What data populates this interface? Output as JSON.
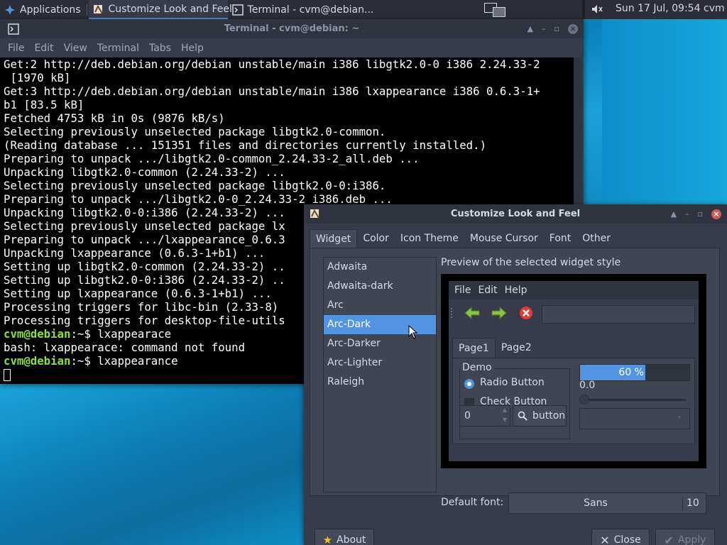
{
  "panel": {
    "applications_label": "Applications",
    "tasks": [
      {
        "label": "Customize Look and Feel",
        "active": true
      },
      {
        "label": "Terminal - cvm@debian..."
      }
    ],
    "clock": "Sun 17 Jul, 09:54",
    "user": "cvm"
  },
  "terminal": {
    "title": "Terminal - cvm@debian: ~",
    "menu": [
      "File",
      "Edit",
      "View",
      "Terminal",
      "Tabs",
      "Help"
    ],
    "lines": [
      "Get:2 http://deb.debian.org/debian unstable/main i386 libgtk2.0-0 i386 2.24.33-2",
      " [1970 kB]",
      "Get:3 http://deb.debian.org/debian unstable/main i386 lxappearance i386 0.6.3-1+",
      "b1 [83.5 kB]",
      "Fetched 4753 kB in 0s (9876 kB/s)",
      "Selecting previously unselected package libgtk2.0-common.",
      "(Reading database ... 151351 files and directories currently installed.)",
      "Preparing to unpack .../libgtk2.0-common_2.24.33-2_all.deb ...",
      "Unpacking libgtk2.0-common (2.24.33-2) ...",
      "Selecting previously unselected package libgtk2.0-0:i386.",
      "Preparing to unpack .../libgtk2.0-0_2.24.33-2_i386.deb ...",
      "Unpacking libgtk2.0-0:i386 (2.24.33-2) ...",
      "Selecting previously unselected package lx",
      "Preparing to unpack .../lxappearance_0.6.3",
      "Unpacking lxappearance (0.6.3-1+b1) ...",
      "Setting up libgtk2.0-common (2.24.33-2) ..",
      "Setting up libgtk2.0-0:i386 (2.24.33-2) ..",
      "Setting up lxappearance (0.6.3-1+b1) ...",
      "Processing triggers for libc-bin (2.33-8)",
      "Processing triggers for desktop-file-utils"
    ],
    "prompt_user": "cvm@debian",
    "prompt_suffix": ":~$ ",
    "cmd1": "lxappearace",
    "error_line": "bash: lxappearace: command not found",
    "cmd2": "lxappearance"
  },
  "dialog": {
    "title": "Customize Look and Feel",
    "tabs": [
      "Widget",
      "Color",
      "Icon Theme",
      "Mouse Cursor",
      "Font",
      "Other"
    ],
    "themes": [
      "Adwaita",
      "Adwaita-dark",
      "Arc",
      "Arc-Dark",
      "Arc-Darker",
      "Arc-Lighter",
      "Raleigh"
    ],
    "selected_theme_index": 3,
    "preview_label": "Preview of the selected widget style",
    "preview": {
      "menu": [
        "File",
        "Edit",
        "Help"
      ],
      "tabs": [
        "Page1",
        "Page2"
      ],
      "demo_legend": "Demo",
      "radio_label": "Radio Button",
      "check_label": "Check Button",
      "spin_value": "0",
      "button_label": "button",
      "progress_fraction": 0.6,
      "progress_text": "60 %",
      "slider_value": "0.0"
    },
    "default_font_label": "Default font:",
    "font_name": "Sans",
    "font_size": "10",
    "about_label": "About",
    "close_label": "Close",
    "apply_label": "Apply"
  },
  "colors": {
    "accent": "#5294e2",
    "panel_bg": "#2b2e37",
    "window_bg": "#383c4a",
    "prompt_green": "#8ae234"
  }
}
